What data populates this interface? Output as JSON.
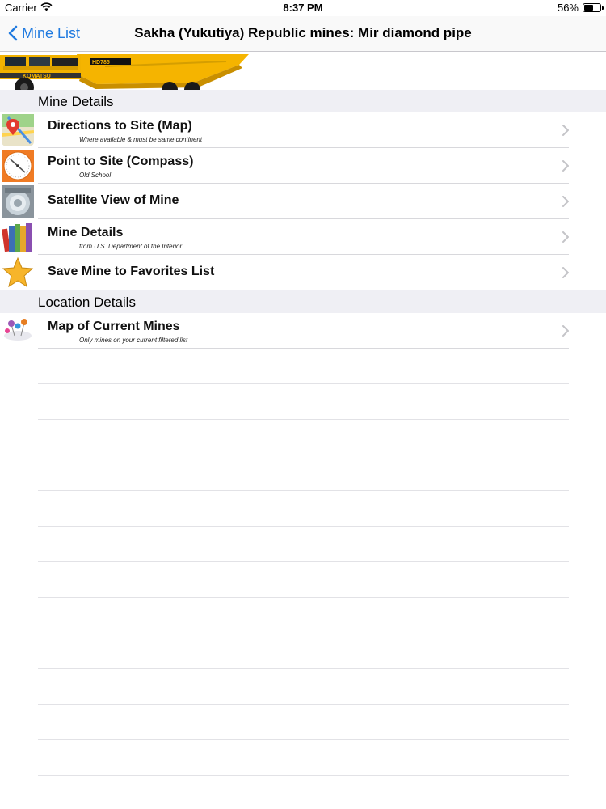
{
  "status_bar": {
    "carrier": "Carrier",
    "time": "8:37 PM",
    "battery": "56%",
    "battery_level": 0.56
  },
  "nav": {
    "back_label": "Mine List",
    "title": "Sakha (Yukutiya) Republic mines: Mir diamond pipe"
  },
  "banner": {
    "brand_text": "KOMATSU",
    "model_text": "HD785"
  },
  "sections": [
    {
      "header": "Mine Details",
      "rows": [
        {
          "title": "Directions to Site (Map)",
          "subtitle": "Where available & must be same continent",
          "icon": "map-directions-icon"
        },
        {
          "title": "Point to Site (Compass)",
          "subtitle": "Old School",
          "icon": "compass-icon"
        },
        {
          "title": "Satellite View of Mine",
          "subtitle": "",
          "icon": "satellite-icon"
        },
        {
          "title": "Mine Details",
          "subtitle": "from U.S. Department of the Interior",
          "icon": "books-icon"
        },
        {
          "title": "Save Mine to Favorites List",
          "subtitle": "",
          "icon": "star-icon"
        }
      ]
    },
    {
      "header": "Location Details",
      "rows": [
        {
          "title": "Map of Current Mines",
          "subtitle": "Only mines on your current filtered list",
          "icon": "map-pins-icon"
        }
      ]
    }
  ],
  "colors": {
    "accent": "#1f7ae0",
    "section_bg": "#efeff4",
    "separator": "#d8d8dc",
    "banner_yellow": "#f5b400"
  }
}
